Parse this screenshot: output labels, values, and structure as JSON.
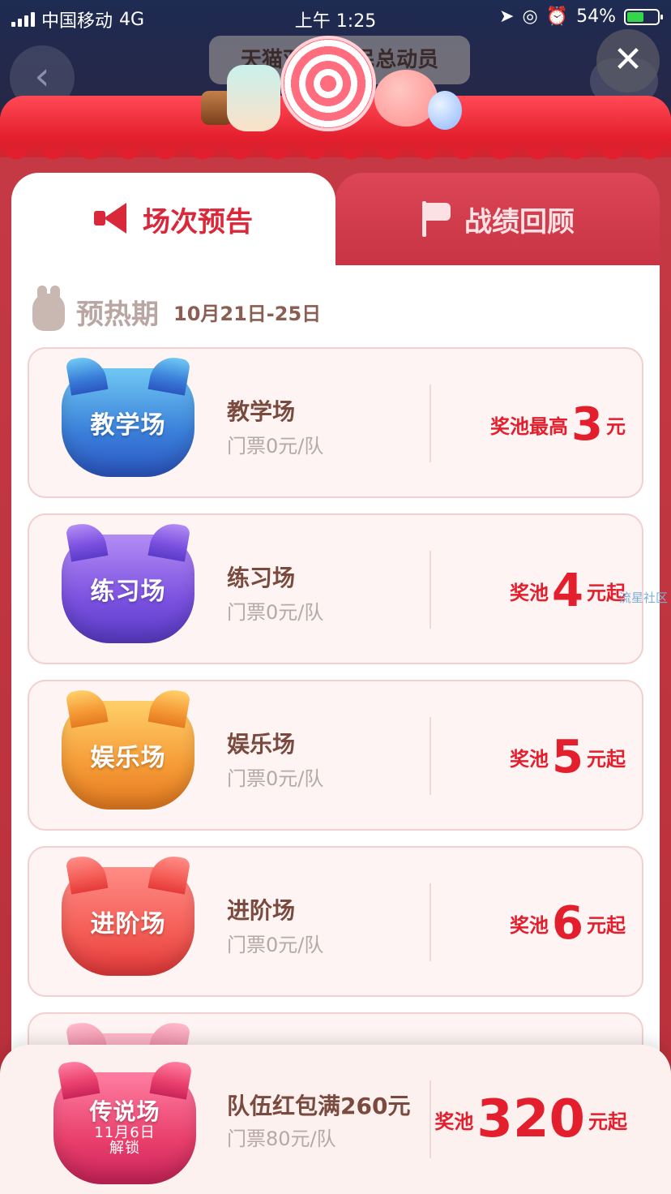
{
  "status_bar": {
    "carrier": "中国移动",
    "network": "4G",
    "time": "上午 1:25",
    "battery": "54%"
  },
  "background_page": {
    "title": "天猫双11全民总动员"
  },
  "tabs": [
    {
      "label": "场次预告",
      "active": true,
      "icon": "megaphone-icon"
    },
    {
      "label": "战绩回顾",
      "active": false,
      "icon": "flag-icon"
    }
  ],
  "section": {
    "title": "预热期",
    "date_range": "10月21日-25日"
  },
  "sessions": [
    {
      "badge": "教学场",
      "name": "教学场",
      "ticket": "门票0元/队",
      "prize_label": "奖池最高",
      "prize_value": "3",
      "prize_unit": "元",
      "color": "#3a7ed9"
    },
    {
      "badge": "练习场",
      "name": "练习场",
      "ticket": "门票0元/队",
      "prize_label": "奖池",
      "prize_value": "4",
      "prize_unit": "元起",
      "color": "#7b51e0"
    },
    {
      "badge": "娱乐场",
      "name": "娱乐场",
      "ticket": "门票0元/队",
      "prize_label": "奖池",
      "prize_value": "5",
      "prize_unit": "元起",
      "color": "#f59a36"
    },
    {
      "badge": "进阶场",
      "name": "进阶场",
      "ticket": "门票0元/队",
      "prize_label": "奖池",
      "prize_value": "6",
      "prize_unit": "元起",
      "color": "#f45d56"
    }
  ],
  "bottom_session": {
    "badge": "传说场",
    "badge_date": "11月6日",
    "badge_status": "解锁",
    "name": "队伍红包满260元",
    "ticket": "门票80元/队",
    "prize_label": "奖池",
    "prize_value": "320",
    "prize_unit": "元起"
  },
  "watermark": "流星社区",
  "colors": {
    "accent_red": "#e41f2d",
    "modal_red": "#c53a44",
    "card_bg": "#fdf4f3"
  }
}
